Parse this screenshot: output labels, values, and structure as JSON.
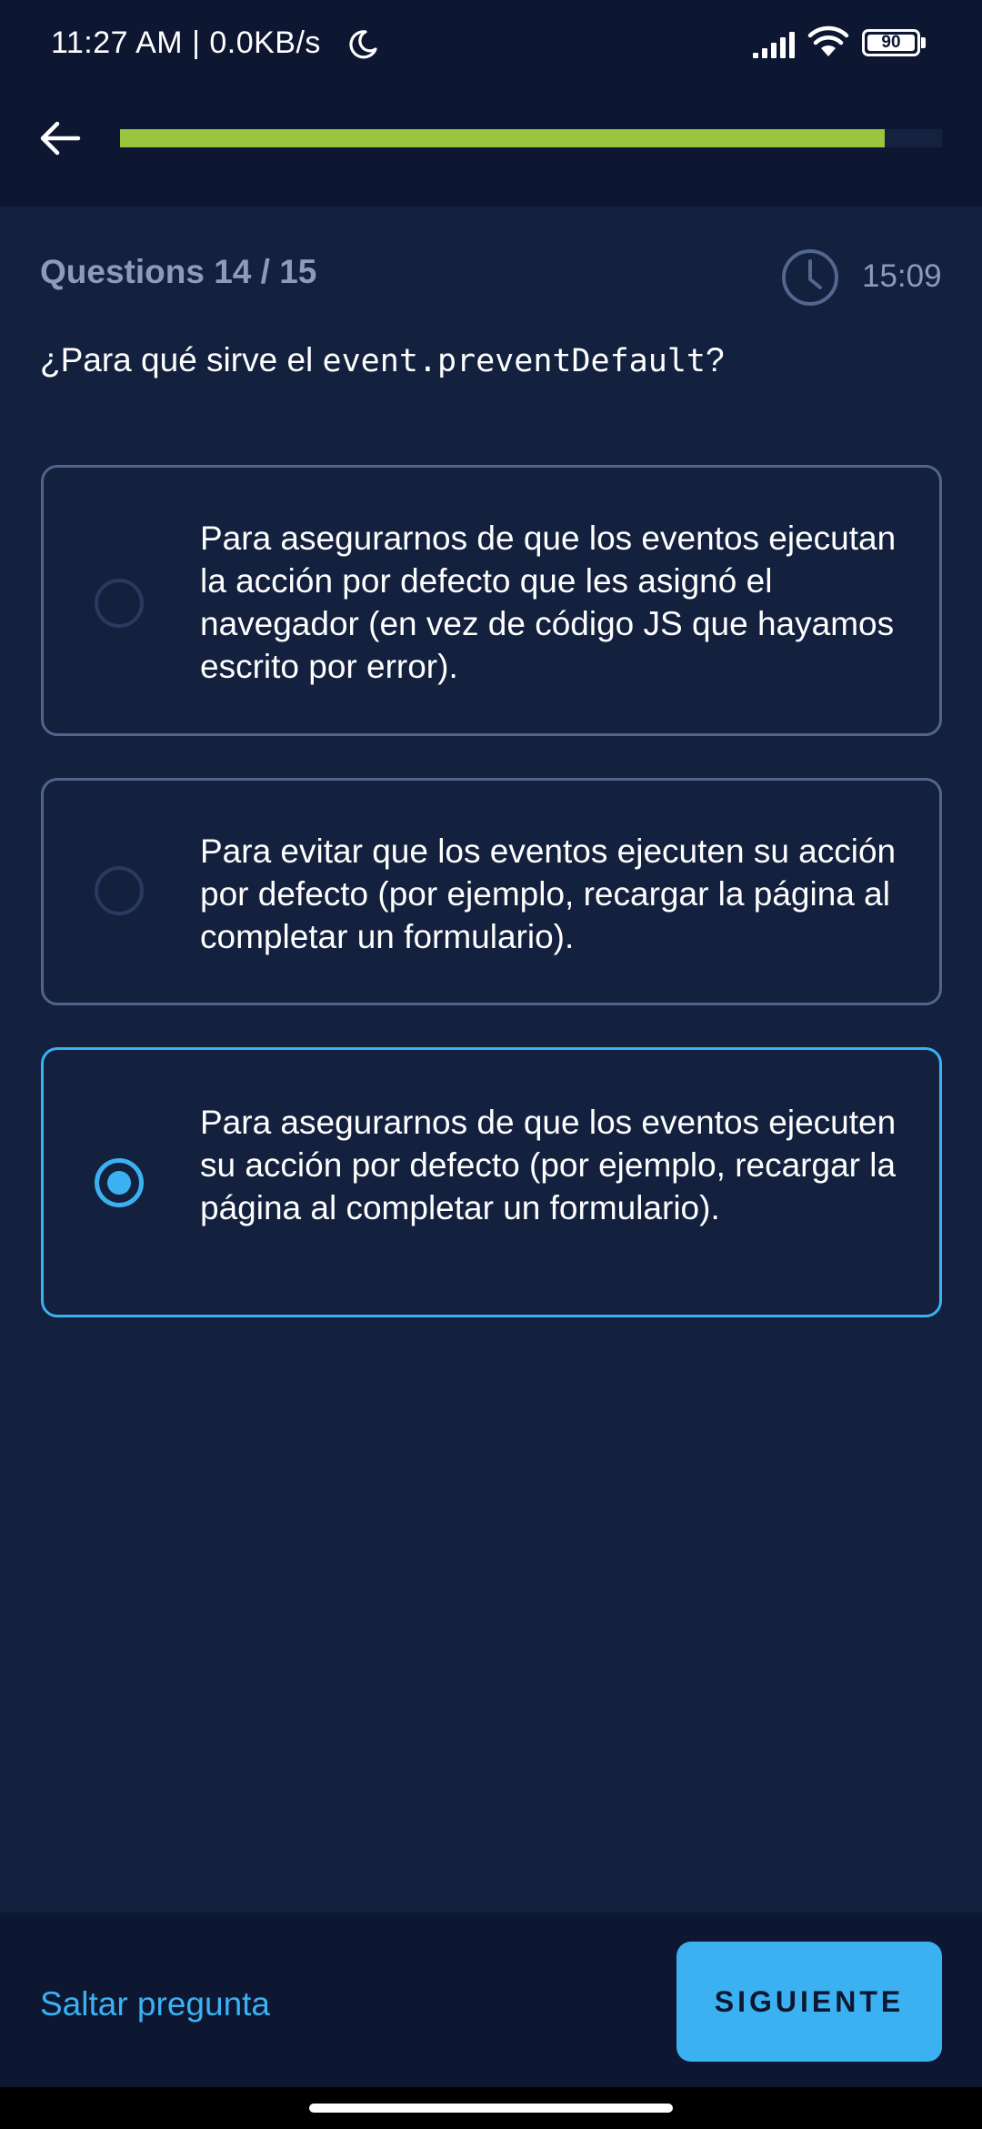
{
  "status_bar": {
    "time": "11:27 AM | 0.0KB/s",
    "battery_level": "90",
    "icons": [
      "moon-icon",
      "signal-icon",
      "wifi-icon",
      "battery-icon"
    ]
  },
  "top_bar": {
    "back_icon": "arrow-left-icon",
    "progress_fraction": 0.93
  },
  "quiz": {
    "counter": "Questions 14 / 15",
    "timer": "15:09",
    "question_prefix": "¿Para qué sirve el ",
    "question_code": "event.preventDefault",
    "question_suffix": "?",
    "options": [
      {
        "text": "Para asegurarnos de que los eventos ejecutan la acción por defecto que les asignó el navegador (en vez de código JS que hayamos escrito por error).",
        "selected": false
      },
      {
        "text": "Para evitar que los eventos ejecuten su acción por defecto (por ejemplo, recargar la página al completar un formulario).",
        "selected": false
      },
      {
        "text": "Para asegurarnos de que los eventos ejecuten su acción por defecto (por ejemplo, recargar la página al completar un formulario).",
        "selected": true
      }
    ]
  },
  "footer": {
    "skip_label": "Saltar pregunta",
    "next_label": "SIGUIENTE"
  },
  "colors": {
    "background": "#13203e",
    "bar": "#0d1731",
    "accent": "#3bb1f2",
    "progress": "#9bc53d",
    "muted_text": "#8d9bb9",
    "option_border": "#51658b"
  }
}
